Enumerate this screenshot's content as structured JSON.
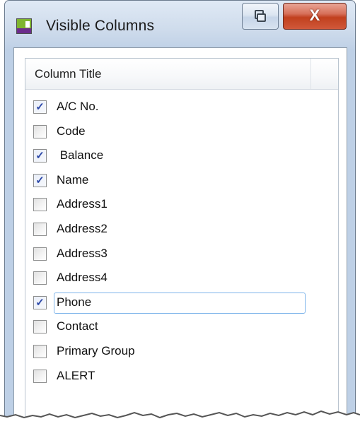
{
  "window": {
    "title": "Visible Columns",
    "close_glyph": "X",
    "restore_icon": "restore-window-icon",
    "app_icon": "app-window-icon"
  },
  "grid": {
    "column_header": "Column Title",
    "items": [
      {
        "label": "A/C No.",
        "checked": true
      },
      {
        "label": "Code",
        "checked": false
      },
      {
        "label": " Balance",
        "checked": true
      },
      {
        "label": "Name",
        "checked": true
      },
      {
        "label": "Address1",
        "checked": false
      },
      {
        "label": "Address2",
        "checked": false
      },
      {
        "label": "Address3",
        "checked": false
      },
      {
        "label": "Address4",
        "checked": false
      },
      {
        "label": "Phone",
        "checked": true,
        "editing": true
      },
      {
        "label": "Contact",
        "checked": false
      },
      {
        "label": "Primary Group",
        "checked": false
      },
      {
        "label": "ALERT",
        "checked": false
      }
    ],
    "check_glyph": "✓"
  },
  "colors": {
    "accent_check": "#2c48a8",
    "selection_border": "#7eb4ea",
    "close_button": "#c1401e"
  }
}
